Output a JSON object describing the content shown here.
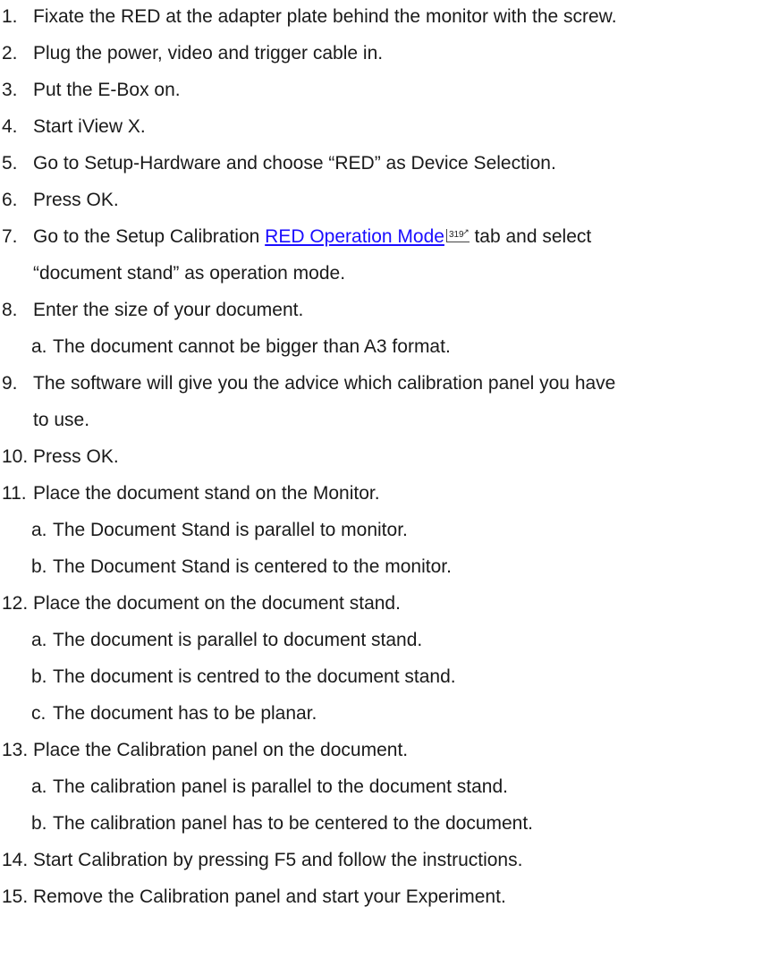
{
  "steps": [
    {
      "num": "1.",
      "text": "Fixate the RED at the adapter plate behind the monitor with the screw."
    },
    {
      "num": "2.",
      "text": "Plug the power, video and trigger cable in."
    },
    {
      "num": "3.",
      "text": "Put the E-Box on."
    },
    {
      "num": "4.",
      "text": "Start iView X."
    },
    {
      "num": "5.",
      "text": "Go to Setup-Hardware and choose “RED” as Device Selection."
    },
    {
      "num": "6.",
      "text": "Press OK."
    },
    {
      "num": "7.",
      "text_before": "Go to the Setup Calibration ",
      "link": "RED Operation Mode",
      "page_ref": "319",
      "text_after": " tab and select",
      "cont": "“document stand” as operation mode."
    },
    {
      "num": "8.",
      "text": "Enter the size of your document.",
      "subs": [
        {
          "letter": "a.",
          "text": "The document cannot be bigger than A3 format."
        }
      ]
    },
    {
      "num": "9.",
      "text": "The software will give you the advice which calibration panel you have",
      "cont": "to use."
    },
    {
      "num": "10.",
      "text": "Press OK."
    },
    {
      "num": "11.",
      "text": "Place the document stand on the Monitor.",
      "subs": [
        {
          "letter": "a.",
          "text": "The Document Stand is parallel to monitor."
        },
        {
          "letter": "b.",
          "text": "The Document Stand is centered to the monitor."
        }
      ]
    },
    {
      "num": "12.",
      "text": "Place the document on the document stand.",
      "subs": [
        {
          "letter": "a.",
          "text": "The document is parallel to document stand."
        },
        {
          "letter": "b.",
          "text": "The document is centred to the document stand."
        },
        {
          "letter": "c.",
          "text": "The document has to be planar."
        }
      ]
    },
    {
      "num": "13.",
      "text": "Place the Calibration panel on the document.",
      "subs": [
        {
          "letter": "a.",
          "text": "The calibration panel is parallel to the document stand."
        },
        {
          "letter": "b.",
          "text": "The calibration panel has to be centered to the document."
        }
      ]
    },
    {
      "num": "14.",
      "text": "Start Calibration by pressing F5 and follow the instructions."
    },
    {
      "num": "15.",
      "text": "Remove the Calibration panel and start your Experiment."
    }
  ],
  "colors": {
    "link": "#1a0dff",
    "text": "#1a1a1a"
  }
}
